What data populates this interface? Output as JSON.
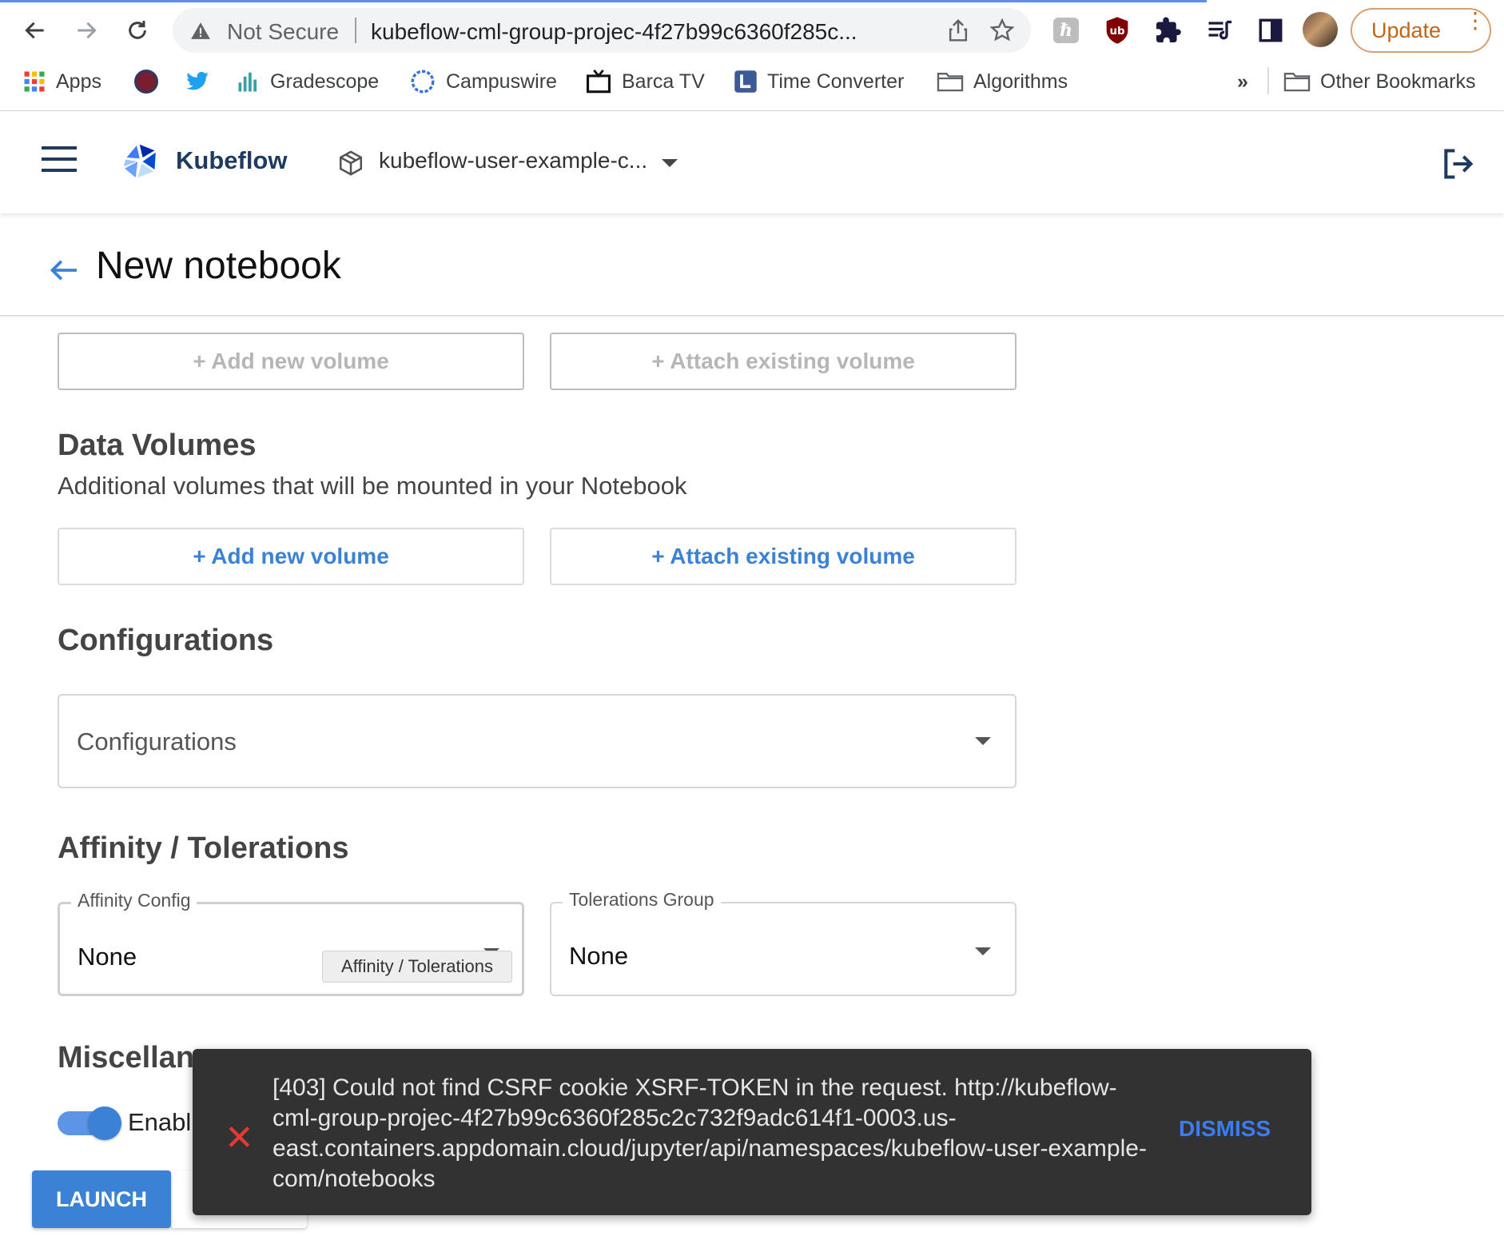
{
  "browser": {
    "security_label": "Not Secure",
    "url": "kubeflow-cml-group-projec-4f27b99c6360f285c...",
    "update_label": "Update",
    "bookmarks": [
      {
        "label": "Apps",
        "icon": "apps-grid-icon"
      },
      {
        "label": "",
        "icon": "site-favicon-icon"
      },
      {
        "label": "",
        "icon": "twitter-icon"
      },
      {
        "label": "Gradescope",
        "icon": "gradescope-icon"
      },
      {
        "label": "Campuswire",
        "icon": "campuswire-icon"
      },
      {
        "label": "Barca TV",
        "icon": "tv-icon"
      },
      {
        "label": "Time Converter",
        "icon": "time-converter-icon"
      },
      {
        "label": "Algorithms",
        "icon": "folder-icon"
      }
    ],
    "overflow_label": "»",
    "other_bookmarks": "Other Bookmarks"
  },
  "header": {
    "brand": "Kubeflow",
    "namespace": "kubeflow-user-example-c..."
  },
  "page": {
    "title": "New notebook",
    "workspace_buttons": {
      "add_new": "+ Add new volume",
      "attach_existing": "+ Attach existing volume"
    },
    "data_volumes": {
      "heading": "Data Volumes",
      "subtitle": "Additional volumes that will be mounted in your Notebook",
      "add_new": "+ Add new volume",
      "attach_existing": "+ Attach existing volume"
    },
    "configurations": {
      "heading": "Configurations",
      "placeholder": "Configurations"
    },
    "affinity": {
      "heading": "Affinity / Tolerations",
      "affinity_label": "Affinity Config",
      "affinity_value": "None",
      "tolerations_label": "Tolerations Group",
      "tolerations_value": "None",
      "tooltip": "Affinity / Tolerations"
    },
    "misc": {
      "heading_visible": "Miscellan",
      "toggle_label_visible": "Enabl",
      "toggle_on": true
    },
    "launch_label": "LAUNCH"
  },
  "snackbar": {
    "message": "[403] Could not find CSRF cookie XSRF-TOKEN in the request. http://kubeflow-cml-group-projec-4f27b99c6360f285c2c732f9adc614f1-0003.us-east.containers.appdomain.cloud/jupyter/api/namespaces/kubeflow-user-example-com/notebooks",
    "action": "DISMISS"
  },
  "colors": {
    "accent": "#3b82d6",
    "error": "#e53935",
    "snackbar_bg": "#323232"
  }
}
